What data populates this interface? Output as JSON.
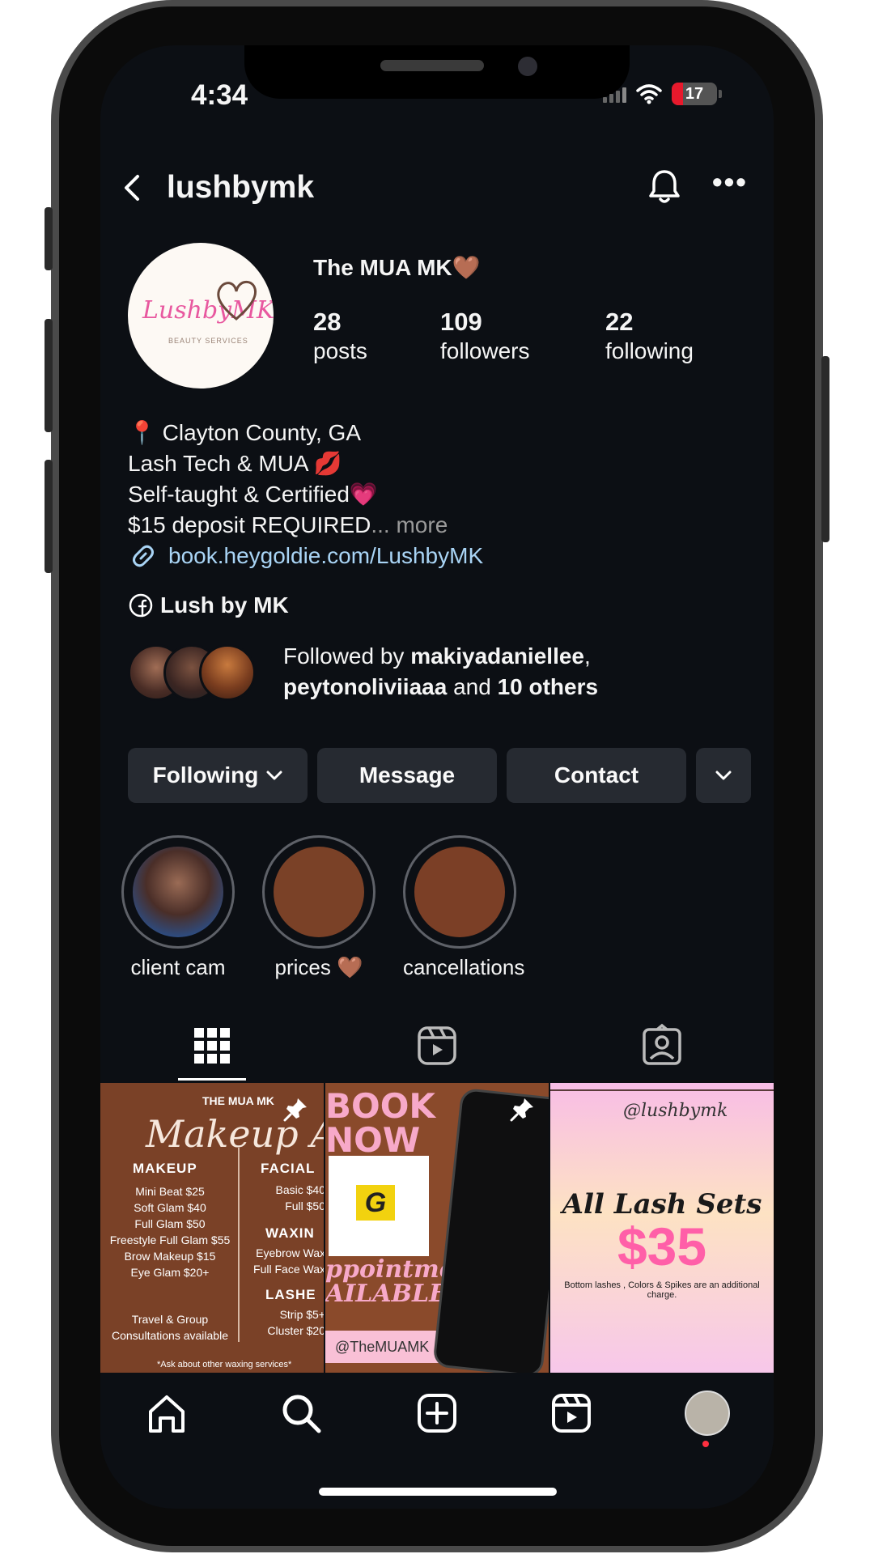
{
  "status_bar": {
    "time": "4:34",
    "battery": "17"
  },
  "header": {
    "username": "lushbymk"
  },
  "profile": {
    "avatar_text": "LushbyMK",
    "display_name": "The MUA MK🤎",
    "stats": [
      {
        "value": "28",
        "label": "posts"
      },
      {
        "value": "109",
        "label": "followers"
      },
      {
        "value": "22",
        "label": "following"
      }
    ],
    "bio": [
      "📍 Clayton County, GA",
      "Lash Tech & MUA 💋",
      "Self-taught & Certified💗",
      "$15 deposit REQUIRED"
    ],
    "bio_more": "... more",
    "link": "book.heygoldie.com/LushbyMK",
    "facebook": "Lush by MK",
    "followed_by": {
      "prefix": "Followed by ",
      "user1": "makiyadaniellee",
      "sep": ",",
      "user2": "peytonoliviiaaa",
      "and": " and ",
      "others": "10 others"
    }
  },
  "actions": {
    "following": "Following",
    "message": "Message",
    "contact": "Contact"
  },
  "highlights": [
    {
      "label": "client cam"
    },
    {
      "label": "prices 🤎"
    },
    {
      "label": "cancellations"
    }
  ],
  "posts": {
    "post1": {
      "brand": "THE MUA MK",
      "script": "Makeup Artist",
      "makeup_heading": "MAKEUP",
      "makeup_items": "Mini Beat $25\nSoft Glam $40\nFull Glam $50\nFreestyle Full Glam $55\nBrow Makeup $15\nEye Glam $20+",
      "facials_heading": "FACIAL",
      "facials_items": "Basic $40\nFull $50",
      "waxing_heading": "WAXIN",
      "waxing_items": "Eyebrow Wax\nFull Face Wax",
      "lashes_heading": "LASHE",
      "lashes_items": "Strip $5+\nCluster $20",
      "group": "Travel & Group\nConsultations available",
      "footer": "*Ask about other waxing services*"
    },
    "post2": {
      "book_now": "BOOK\nNOW",
      "appointments": "ppointments\nAILABLE",
      "handle": "@TheMUAMK"
    },
    "post3": {
      "handle": "@lushbymk",
      "headline": "All Lash Sets",
      "price": "$35",
      "note": "Bottom lashes , Colors & Spikes are an additional charge."
    }
  },
  "colors": {
    "background": "#0c0f14",
    "button": "#262a31",
    "link": "#a9d4f5",
    "notification_dot": "#ff3040"
  },
  "icons": [
    "back-icon",
    "bell-icon",
    "more-icon",
    "link-icon",
    "facebook-icon",
    "chevron-down-icon",
    "grid-icon",
    "reels-icon",
    "tagged-icon",
    "home-icon",
    "search-icon",
    "create-icon",
    "pin-icon"
  ]
}
